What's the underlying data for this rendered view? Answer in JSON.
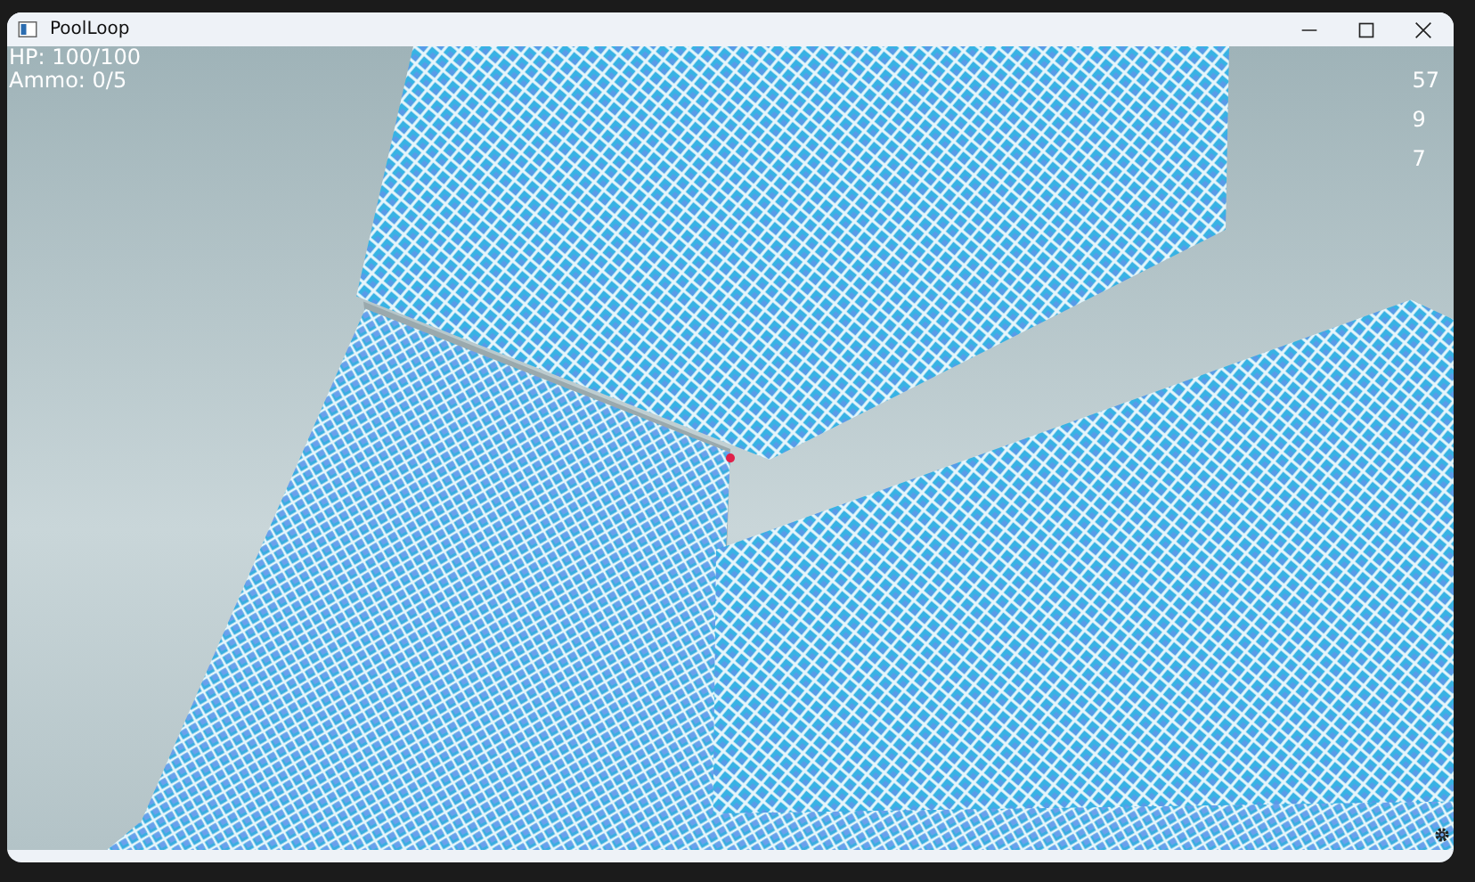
{
  "window": {
    "title": "PoolLoop"
  },
  "hud": {
    "lines": [
      "HP: 100/100",
      "Ammo: 0/5"
    ],
    "stats": [
      "57",
      "9",
      "7"
    ]
  }
}
